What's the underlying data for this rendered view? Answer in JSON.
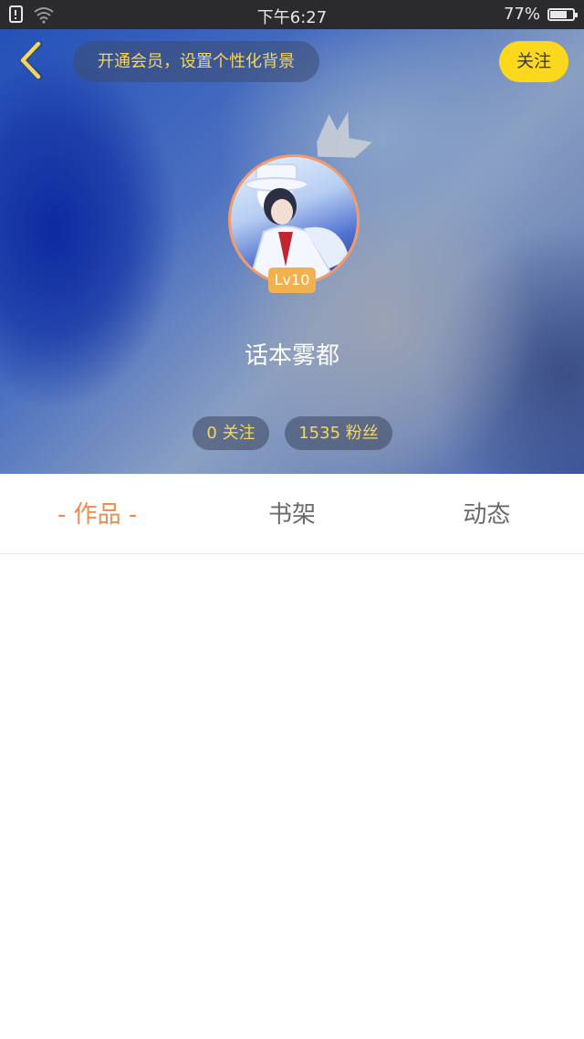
{
  "status_bar": {
    "time": "下午6:27",
    "battery": "77%",
    "battery_level": 0.77,
    "icons": [
      "sim-alert-icon",
      "wifi-icon",
      "battery-icon"
    ]
  },
  "header": {
    "back_icon": "chevron-left-icon",
    "vip_banner": "开通会员，设置个性化背景",
    "follow_label": "关注"
  },
  "profile": {
    "username": "话本雾都",
    "level": "Lv10",
    "crown_icon": "crown-icon",
    "stats": {
      "following": "0 关注",
      "fans": "1535 粉丝"
    }
  },
  "tabs": [
    {
      "label": "- 作品 -",
      "active": true
    },
    {
      "label": "书架",
      "active": false
    },
    {
      "label": "动态",
      "active": false
    }
  ],
  "colors": {
    "accent_yellow": "#fbd81c",
    "banner_text": "#f6d65b",
    "active_tab": "#ef8a4d",
    "inactive_tab": "#6a6a6a",
    "level_badge": "#f1b14f",
    "avatar_ring": "#f29a6b"
  }
}
